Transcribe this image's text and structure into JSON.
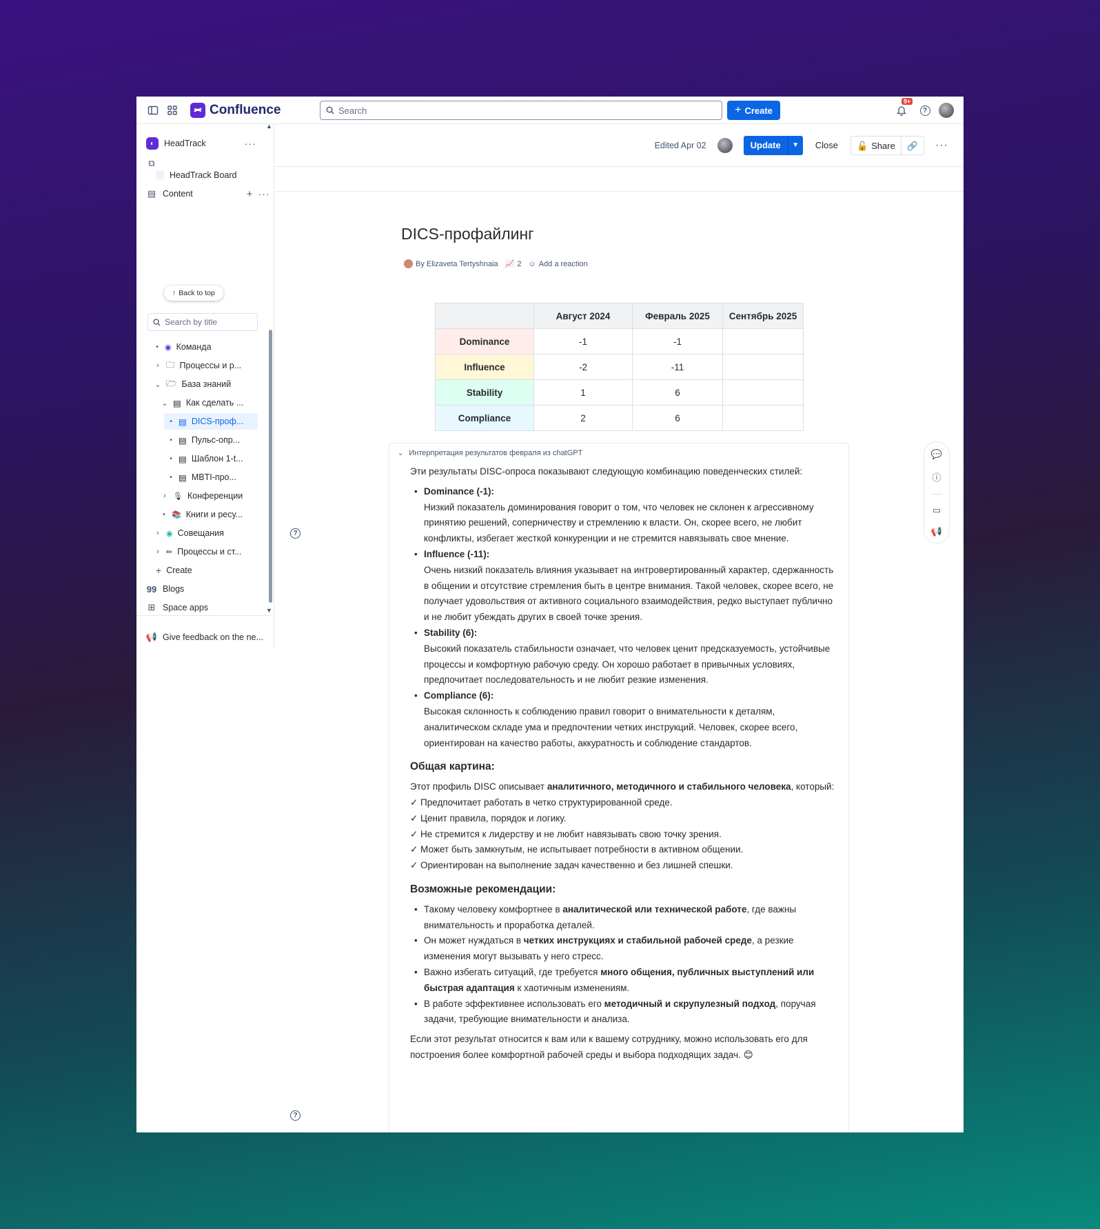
{
  "app": {
    "name": "Confluence"
  },
  "topnav": {
    "search_placeholder": "Search",
    "create_label": "Create",
    "notifications_badge": "9+"
  },
  "sidebar": {
    "space_name": "HeadTrack",
    "board_label": "HeadTrack Board",
    "back_to_top": "Back to top",
    "content_label": "Content",
    "search_placeholder": "Search by title",
    "tree": [
      {
        "label": "Команда"
      },
      {
        "label": "Процессы и р..."
      },
      {
        "label": "База знаний"
      },
      {
        "label": "Как сделать ..."
      },
      {
        "label": "DICS-проф..."
      },
      {
        "label": "Пульс-опр..."
      },
      {
        "label": "Шаблон 1-t..."
      },
      {
        "label": "MBTI-про..."
      },
      {
        "label": "Конференции"
      },
      {
        "label": "Книги и ресу..."
      },
      {
        "label": "Совещания"
      },
      {
        "label": "Процессы и ст..."
      }
    ],
    "create_label": "Create",
    "blogs_label": "Blogs",
    "space_apps_label": "Space apps",
    "feedback_label": "Give feedback on the ne..."
  },
  "toolbar": {
    "edited": "Edited Apr 02",
    "update": "Update",
    "close": "Close",
    "share": "Share"
  },
  "page": {
    "title": "DICS-профайлинг",
    "author": "By Elizaveta Tertyshnaia",
    "views": "2",
    "add_reaction": "Add a reaction"
  },
  "table": {
    "headers": [
      "",
      "Август 2024",
      "Февраль 2025",
      "Сентябрь 2025"
    ],
    "rows": [
      {
        "label": "Dominance",
        "v1": "-1",
        "v2": "-1",
        "v3": "",
        "color": "#ffeceb"
      },
      {
        "label": "Influence",
        "v1": "-2",
        "v2": "-11",
        "v3": "",
        "color": "#fff7d6"
      },
      {
        "label": "Stability",
        "v1": "1",
        "v2": "6",
        "v3": "",
        "color": "#dcfff1"
      },
      {
        "label": "Compliance",
        "v1": "2",
        "v2": "6",
        "v3": "",
        "color": "#e7f8ff"
      }
    ]
  },
  "expand": {
    "title": "Интерпретация результатов февраля из chatGPT",
    "intro": "Эти результаты DISC-опроса показывают следующую комбинацию поведенческих стилей:",
    "styles": [
      {
        "name": "Dominance (-1):",
        "text": "Низкий показатель доминирования говорит о том, что человек не склонен к агрессивному принятию решений, соперничеству и стремлению к власти. Он, скорее всего, не любит конфликты, избегает жесткой конкуренции и не стремится навязывать свое мнение."
      },
      {
        "name": "Influence (-11):",
        "text": "Очень низкий показатель влияния указывает на интровертированный характер, сдержанность в общении и отсутствие стремления быть в центре внимания. Такой человек, скорее всего, не получает удовольствия от активного социального взаимодействия, редко выступает публично и не любит убеждать других в своей точке зрения."
      },
      {
        "name": "Stability (6):",
        "text": "Высокий показатель стабильности означает, что человек ценит предсказуемость, устойчивые процессы и комфортную рабочую среду. Он хорошо работает в привычных условиях, предпочитает последовательность и не любит резкие изменения."
      },
      {
        "name": "Compliance (6):",
        "text": "Высокая склонность к соблюдению правил говорит о внимательности к деталям, аналитическом складе ума и предпочтении четких инструкций. Человек, скорее всего, ориентирован на качество работы, аккуратность и соблюдение стандартов."
      }
    ],
    "overall_heading": "Общая картина:",
    "overall_intro_a": "Этот профиль DISC описывает ",
    "overall_intro_b": "аналитичного, методичного и стабильного человека",
    "overall_intro_c": ", который:",
    "checks": [
      "✓ Предпочитает работать в четко структурированной среде.",
      "✓ Ценит правила, порядок и логику.",
      "✓ Не стремится к лидерству и не любит навязывать свою точку зрения.",
      "✓ Может быть замкнутым, не испытывает потребности в активном общении.",
      "✓ Ориентирован на выполнение задач качественно и без лишней спешки."
    ],
    "rec_heading": "Возможные рекомендации:",
    "recs": [
      {
        "a": "Такому человеку комфортнее в ",
        "b": "аналитической или технической работе",
        "c": ", где важны внимательность и проработка деталей."
      },
      {
        "a": "Он может нуждаться в ",
        "b": "четких инструкциях и стабильной рабочей среде",
        "c": ", а резкие изменения могут вызывать у него стресс."
      },
      {
        "a": "Важно избегать ситуаций, где требуется ",
        "b": "много общения, публичных выступлений или быстрая адаптация",
        "c": " к хаотичным изменениям."
      },
      {
        "a": "В работе эффективнее использовать его ",
        "b": "методичный и скрупулезный подход",
        "c": ", поручая задачи, требующие внимательности и анализа."
      }
    ],
    "closing": "Если этот результат относится к вам или к вашему сотруднику, можно использовать его для построения более комфортной рабочей среды и выбора подходящих задач. 😊"
  }
}
